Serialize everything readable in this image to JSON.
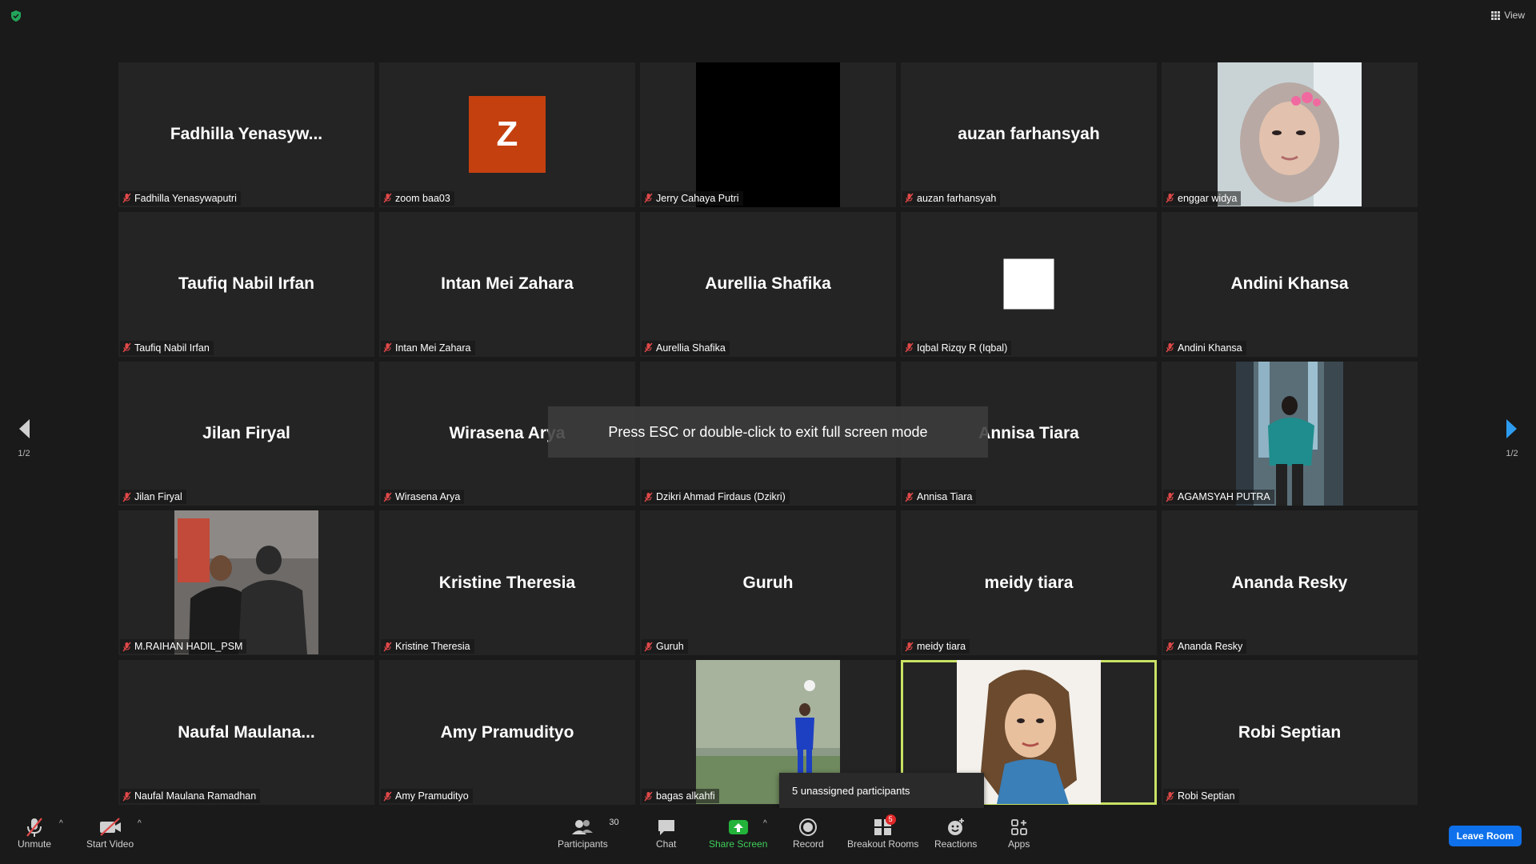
{
  "top": {
    "view_label": "View"
  },
  "nav": {
    "page_left": "1/2",
    "page_right": "1/2"
  },
  "toast": "Press ESC or double-click to exit full screen mode",
  "tiles": [
    {
      "big": "Fadhilla  Yenasyw...",
      "label": "Fadhilla Yenasywaputri"
    },
    {
      "big": "",
      "label": "zoom baa03",
      "avatar": "Z"
    },
    {
      "big": "",
      "label": "Jerry Cahaya Putri"
    },
    {
      "big": "auzan farhansyah",
      "label": "auzan farhansyah"
    },
    {
      "big": "",
      "label": "enggar widya"
    },
    {
      "big": "Taufiq Nabil Irfan",
      "label": "Taufiq Nabil Irfan"
    },
    {
      "big": "Intan Mei Zahara",
      "label": "Intan Mei Zahara"
    },
    {
      "big": "Aurellia Shafika",
      "label": "Aurellia Shafika"
    },
    {
      "big": "",
      "label": "Iqbal Rizqy R (Iqbal)"
    },
    {
      "big": "Andini Khansa",
      "label": "Andini Khansa"
    },
    {
      "big": "Jilan Firyal",
      "label": "Jilan Firyal"
    },
    {
      "big": "Wirasena Arya",
      "label": "Wirasena Arya"
    },
    {
      "big": "",
      "label": "Dzikri Ahmad Firdaus (Dzikri)"
    },
    {
      "big": "Annisa Tiara",
      "label": "Annisa Tiara"
    },
    {
      "big": "",
      "label": "AGAMSYAH PUTRA"
    },
    {
      "big": "",
      "label": "M.RAIHAN HADIL_PSM"
    },
    {
      "big": "Kristine Theresia",
      "label": "Kristine Theresia"
    },
    {
      "big": "Guruh",
      "label": "Guruh"
    },
    {
      "big": "meidy tiara",
      "label": "meidy tiara"
    },
    {
      "big": "Ananda Resky",
      "label": "Ananda Resky"
    },
    {
      "big": "Naufal  Maulana...",
      "label": "Naufal Maulana Ramadhan"
    },
    {
      "big": "Amy Pramudityo",
      "label": "Amy Pramudityo"
    },
    {
      "big": "",
      "label": "bagas alkahfi"
    },
    {
      "big": "",
      "label": ""
    },
    {
      "big": "Robi Septian",
      "label": "Robi Septian"
    }
  ],
  "tooltip": "5 unassigned participants",
  "toolbar": {
    "unmute": "Unmute",
    "start_video": "Start Video",
    "participants": "Participants",
    "participants_count": "30",
    "chat": "Chat",
    "share_screen": "Share Screen",
    "record": "Record",
    "breakout_rooms": "Breakout Rooms",
    "breakout_badge": "5",
    "reactions": "Reactions",
    "apps": "Apps",
    "leave_room": "Leave Room"
  },
  "colors": {
    "accent_green": "#3ecf5a",
    "leave_blue": "#0e71eb",
    "active_border": "#c9e265",
    "avatar_orange": "#c4400f"
  }
}
